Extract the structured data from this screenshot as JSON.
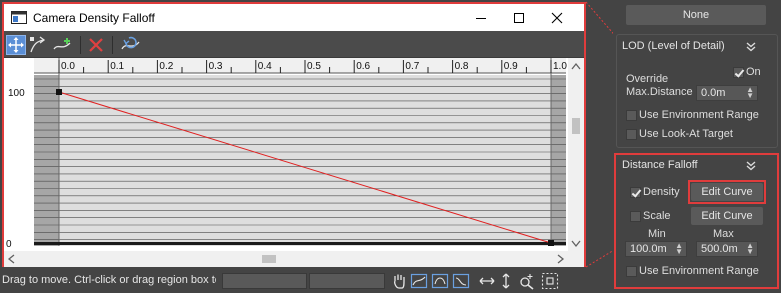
{
  "window": {
    "title": "Camera Density Falloff",
    "controls": [
      "minimize-icon",
      "maximize-icon",
      "close-icon"
    ]
  },
  "toolbar": {
    "icons": [
      "move-keys-icon",
      "scale-keys-icon",
      "insert-point-icon",
      "delete-point-icon",
      "reset-curve-icon"
    ]
  },
  "graph": {
    "ruler_labels": [
      "0.0",
      "0.1",
      "0.2",
      "0.3",
      "0.4",
      "0.5",
      "0.6",
      "0.7",
      "0.8",
      "0.9",
      "1.0",
      "1."
    ],
    "y_top_label": "100",
    "y_bottom_label": "0",
    "curve_points": [
      [
        0.0,
        100
      ],
      [
        1.0,
        0
      ]
    ],
    "curve_color": "#e02020"
  },
  "status": {
    "message": "Drag to move. Ctrl-click or drag region box to"
  },
  "panel": {
    "none_button": "None",
    "lod": {
      "title": "LOD (Level of Detail)",
      "override_label": "Override",
      "max_distance_label": "Max.Distance",
      "on_label": "On",
      "max_distance_value": "0.0m",
      "use_env_range_label": "Use Environment Range",
      "use_look_at_label": "Use Look-At Target"
    },
    "distance_falloff": {
      "title": "Distance Falloff",
      "density_label": "Density",
      "density_checked": true,
      "edit_curve_1": "Edit Curve",
      "scale_label": "Scale",
      "scale_checked": false,
      "edit_curve_2": "Edit Curve",
      "min_label": "Min",
      "max_label": "Max",
      "min_value": "100.0m",
      "max_value": "500.0m",
      "use_env_range_label": "Use Environment Range"
    }
  },
  "colors": {
    "highlight": "#e03c3c",
    "panel_bg": "#444444",
    "button_bg": "#5a5a5a"
  }
}
